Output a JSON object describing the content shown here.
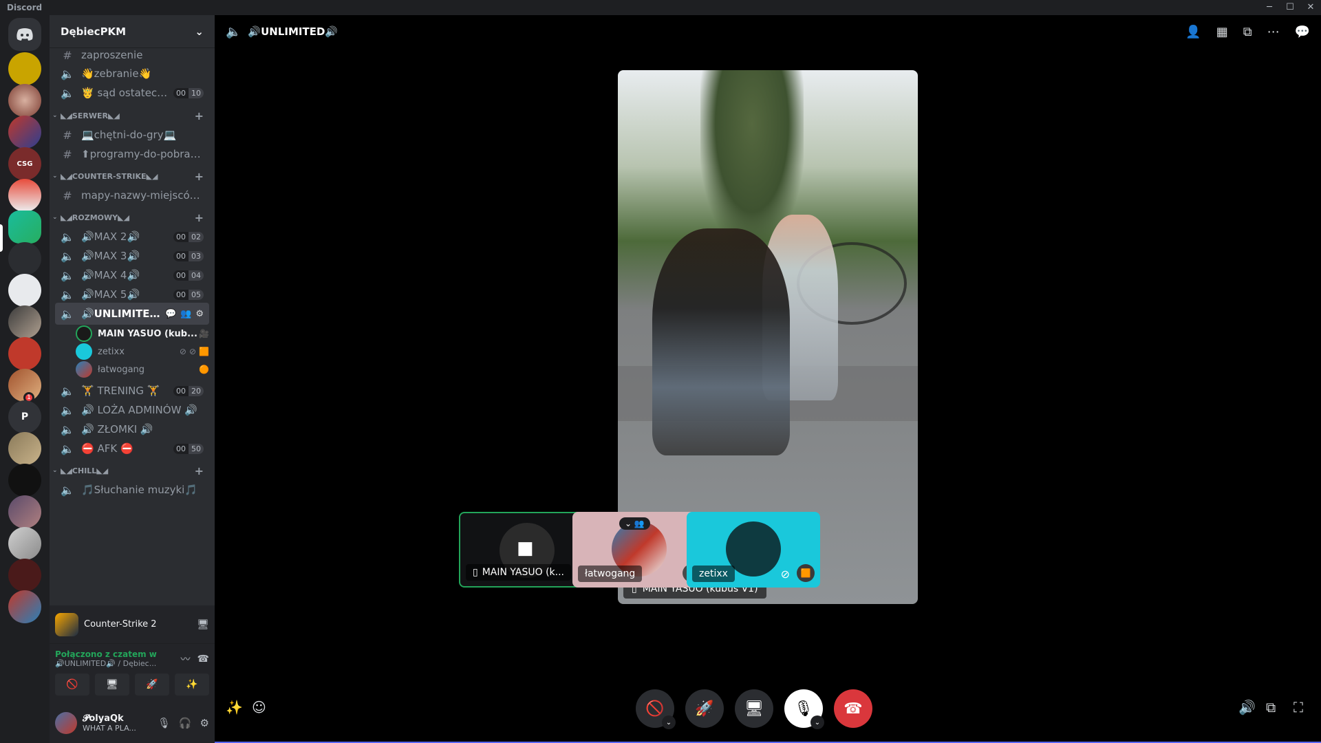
{
  "app": {
    "title": "Discord",
    "window_controls": [
      "─",
      "☐",
      "✕"
    ]
  },
  "server": {
    "name": "DębiecPKM"
  },
  "channels": [
    {
      "name": "zaproszenie",
      "type": "text"
    },
    {
      "name": "👋zebranie👋",
      "type": "voice"
    },
    {
      "name": "🤴 sąd ostatecz...",
      "type": "voice",
      "count_a": "00",
      "count_b": "10"
    }
  ],
  "categories": [
    {
      "name": "◣◢SERWER◣◢"
    },
    {
      "name": "◣◢COUNTER-STRIKE◣◢"
    },
    {
      "name": "◣◢ROZMOWY◣◢"
    },
    {
      "name": "◣◢CHILL◣◢"
    }
  ],
  "serwer_channels": [
    {
      "name": "💻chętni-do-gry💻"
    },
    {
      "name": "⬆programy-do-pobrania⬆"
    }
  ],
  "cs_channels": [
    {
      "name": "mapy-nazwy-miejscówek"
    }
  ],
  "voice_channels": [
    {
      "name": "🔊MAX 2🔊",
      "count_a": "00",
      "count_b": "02"
    },
    {
      "name": "🔊MAX 3🔊",
      "count_a": "00",
      "count_b": "03"
    },
    {
      "name": "🔊MAX 4🔊",
      "count_a": "00",
      "count_b": "04"
    },
    {
      "name": "🔊MAX 5🔊",
      "count_a": "00",
      "count_b": "05"
    },
    {
      "name": "🔊UNLIMITED..."
    },
    {
      "name": "🏋 TRENING 🏋",
      "count_a": "00",
      "count_b": "20"
    },
    {
      "name": "🔊 LOŻA ADMINÓW 🔊"
    },
    {
      "name": "🔊 ZŁOMKI 🔊"
    },
    {
      "name": "⛔ AFK ⛔",
      "count_a": "00",
      "count_b": "50"
    }
  ],
  "voice_users": [
    {
      "name": "MAIN YASUO (kub..."
    },
    {
      "name": "zetixx"
    },
    {
      "name": "łatwogang"
    }
  ],
  "chill_channels": [
    {
      "name": "🎵Słuchanie muzyki🎵"
    }
  ],
  "activity": {
    "game": "Counter-Strike 2"
  },
  "rtc": {
    "status": "Połączono z czatem w",
    "location": "🔊UNLIMITED🔊 / Dębiec..."
  },
  "user": {
    "name": "𝓟olyaQk",
    "status": "WHAT A PLA..."
  },
  "call": {
    "channel_title": "🔊UNLIMITED🔊",
    "stage_label": "MAIN YASUO (kubuś V1)",
    "tiles": [
      {
        "name": "MAIN YASUO (k..."
      },
      {
        "name": "łatwogang"
      },
      {
        "name": "zetixx"
      }
    ]
  },
  "guild_badge": "1",
  "guild_letter": "P",
  "colors": {
    "accent": "#5865f2",
    "connected": "#23a55a",
    "danger": "#da373c",
    "tile_cyan": "#1ac8db"
  }
}
